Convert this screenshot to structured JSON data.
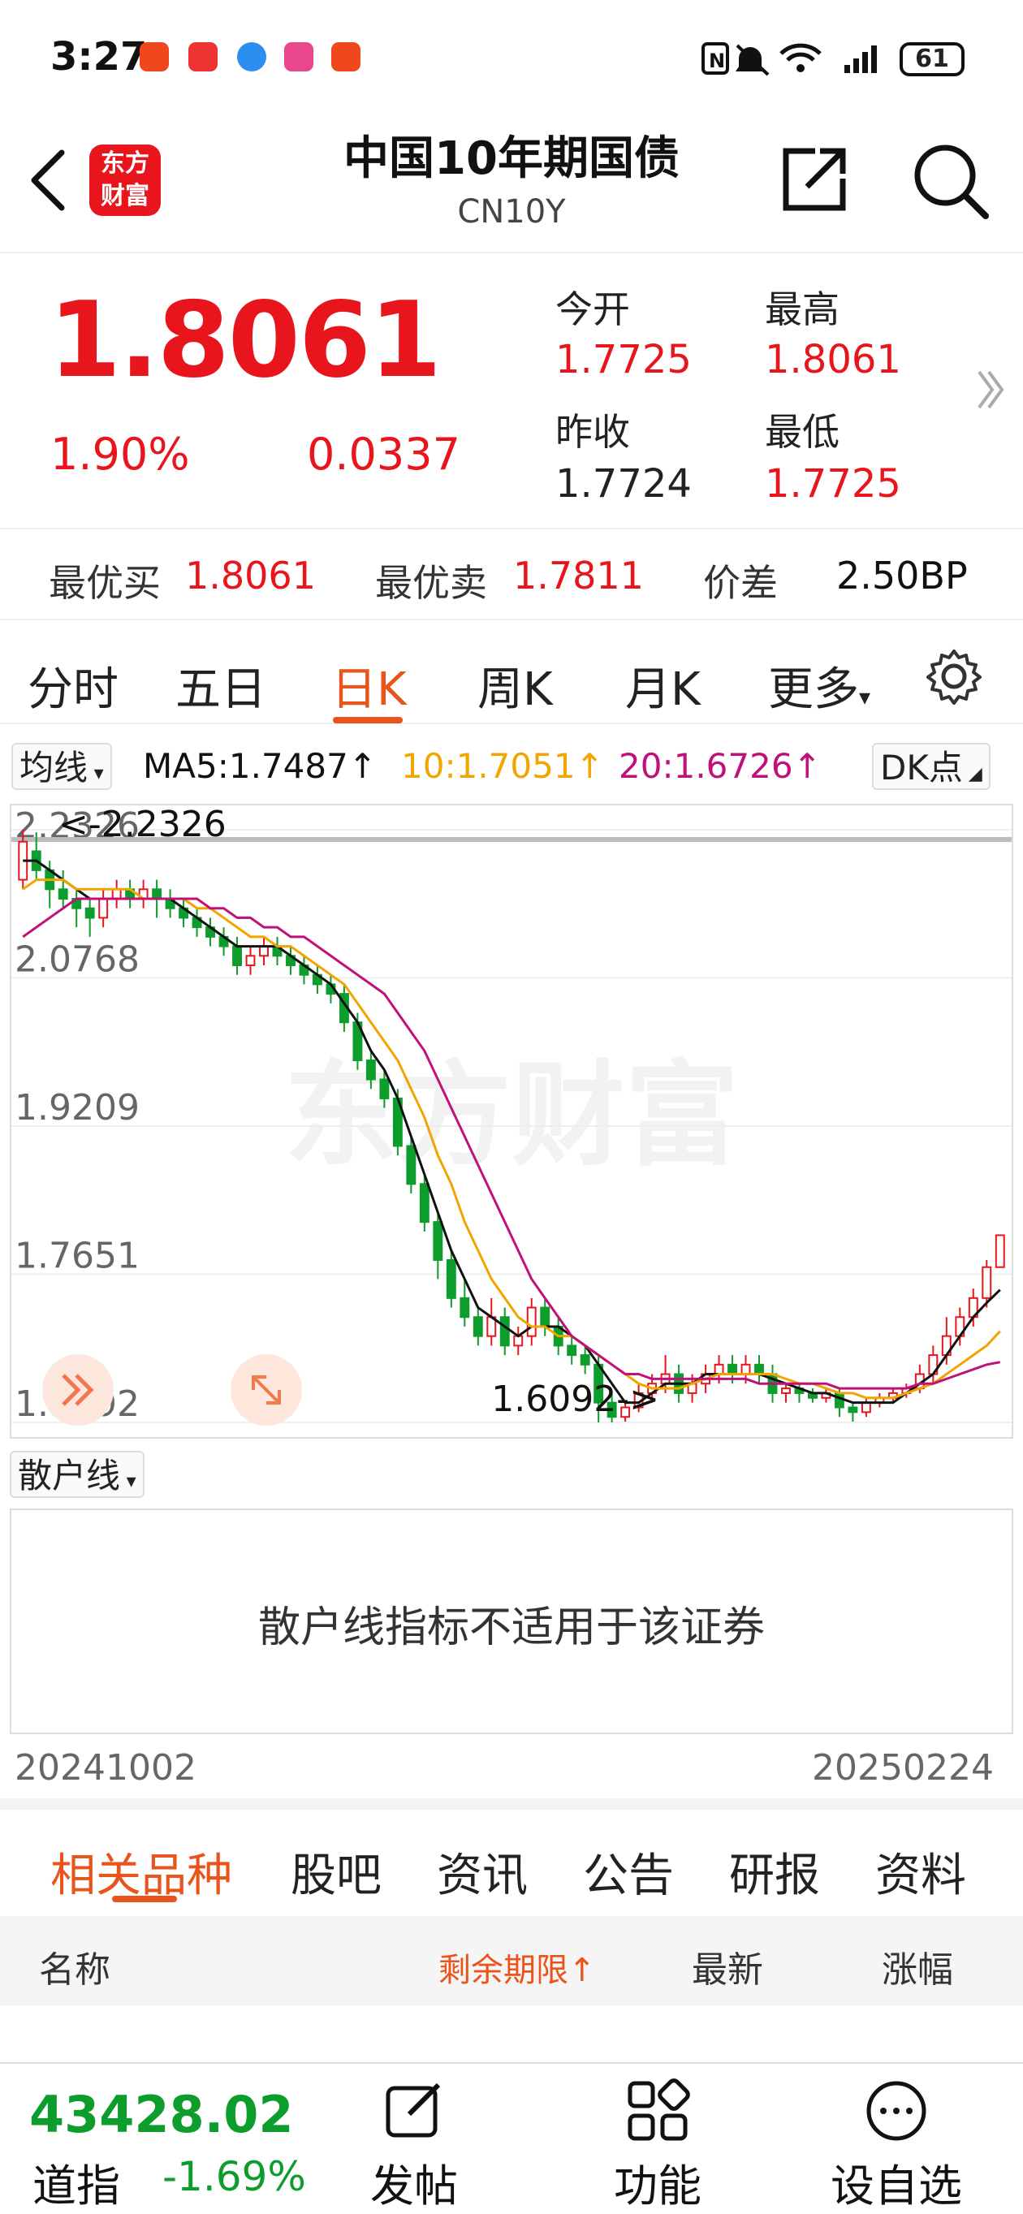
{
  "status": {
    "time": "3:27",
    "battery": "61"
  },
  "header": {
    "title": "中国10年期国债",
    "code": "CN10Y",
    "logo_line1": "东方",
    "logo_line2": "财富"
  },
  "quote": {
    "price": "1.8061",
    "pct": "1.90%",
    "change": "0.0337",
    "open_label": "今开",
    "open": "1.7725",
    "high_label": "最高",
    "high": "1.8061",
    "prev_label": "昨收",
    "prev": "1.7724",
    "low_label": "最低",
    "low": "1.7725"
  },
  "bidask": {
    "bid_label": "最优买",
    "bid": "1.8061",
    "ask_label": "最优卖",
    "ask": "1.7811",
    "spread_label": "价差",
    "spread": "2.50BP"
  },
  "ktabs": [
    "分时",
    "五日",
    "日K",
    "周K",
    "月K",
    "更多"
  ],
  "ma": {
    "selector": "均线",
    "ma5": "MA5:1.7487↑",
    "ma10": "10:1.7051↑",
    "ma20": "20:1.6726↑",
    "dk": "DK点"
  },
  "colors": {
    "up": "#e8161c",
    "down": "#0d9d2c",
    "ma5": "#111111",
    "ma10": "#f0a500",
    "ma20": "#c0117b",
    "accent": "#e8541b"
  },
  "chart_data": {
    "type": "candlestick",
    "y_ticks": [
      "2.2326",
      "2.0768",
      "1.9209",
      "1.7651",
      "1.6092"
    ],
    "ylim": [
      1.6092,
      2.2326
    ],
    "high_marker": "<-2.2326",
    "low_marker": "1.6092->",
    "watermark": "东方财富",
    "x_range": [
      "20241002",
      "20250224"
    ],
    "candles": [
      [
        2.18,
        2.22,
        2.2326,
        2.17
      ],
      [
        2.21,
        2.19,
        2.23,
        2.18
      ],
      [
        2.19,
        2.17,
        2.2,
        2.15
      ],
      [
        2.17,
        2.16,
        2.19,
        2.15
      ],
      [
        2.16,
        2.15,
        2.17,
        2.13
      ],
      [
        2.15,
        2.14,
        2.16,
        2.12
      ],
      [
        2.14,
        2.16,
        2.17,
        2.13
      ],
      [
        2.16,
        2.17,
        2.18,
        2.15
      ],
      [
        2.17,
        2.16,
        2.18,
        2.15
      ],
      [
        2.16,
        2.17,
        2.18,
        2.15
      ],
      [
        2.17,
        2.16,
        2.18,
        2.14
      ],
      [
        2.16,
        2.15,
        2.17,
        2.14
      ],
      [
        2.15,
        2.14,
        2.16,
        2.13
      ],
      [
        2.14,
        2.13,
        2.15,
        2.12
      ],
      [
        2.13,
        2.12,
        2.14,
        2.11
      ],
      [
        2.12,
        2.11,
        2.13,
        2.1
      ],
      [
        2.11,
        2.09,
        2.12,
        2.08
      ],
      [
        2.09,
        2.1,
        2.11,
        2.08
      ],
      [
        2.1,
        2.11,
        2.12,
        2.09
      ],
      [
        2.11,
        2.1,
        2.12,
        2.09
      ],
      [
        2.1,
        2.09,
        2.11,
        2.08
      ],
      [
        2.09,
        2.08,
        2.1,
        2.07
      ],
      [
        2.08,
        2.07,
        2.09,
        2.06
      ],
      [
        2.07,
        2.06,
        2.08,
        2.05
      ],
      [
        2.06,
        2.03,
        2.07,
        2.02
      ],
      [
        2.03,
        1.99,
        2.04,
        1.98
      ],
      [
        1.99,
        1.97,
        2.0,
        1.96
      ],
      [
        1.97,
        1.95,
        1.98,
        1.94
      ],
      [
        1.95,
        1.9,
        1.96,
        1.89
      ],
      [
        1.9,
        1.86,
        1.91,
        1.85
      ],
      [
        1.86,
        1.82,
        1.87,
        1.81
      ],
      [
        1.82,
        1.78,
        1.83,
        1.76
      ],
      [
        1.78,
        1.74,
        1.79,
        1.73
      ],
      [
        1.74,
        1.72,
        1.76,
        1.71
      ],
      [
        1.72,
        1.7,
        1.73,
        1.69
      ],
      [
        1.7,
        1.72,
        1.74,
        1.69
      ],
      [
        1.72,
        1.69,
        1.73,
        1.68
      ],
      [
        1.69,
        1.7,
        1.71,
        1.68
      ],
      [
        1.7,
        1.73,
        1.74,
        1.69
      ],
      [
        1.73,
        1.71,
        1.74,
        1.7
      ],
      [
        1.71,
        1.69,
        1.72,
        1.68
      ],
      [
        1.69,
        1.68,
        1.7,
        1.67
      ],
      [
        1.68,
        1.67,
        1.69,
        1.66
      ],
      [
        1.67,
        1.63,
        1.68,
        1.6092
      ],
      [
        1.63,
        1.615,
        1.64,
        1.6092
      ],
      [
        1.615,
        1.625,
        1.63,
        1.61
      ],
      [
        1.625,
        1.64,
        1.65,
        1.62
      ],
      [
        1.64,
        1.65,
        1.66,
        1.63
      ],
      [
        1.65,
        1.66,
        1.68,
        1.64
      ],
      [
        1.66,
        1.64,
        1.67,
        1.63
      ],
      [
        1.64,
        1.65,
        1.66,
        1.63
      ],
      [
        1.65,
        1.66,
        1.67,
        1.64
      ],
      [
        1.66,
        1.67,
        1.68,
        1.65
      ],
      [
        1.67,
        1.66,
        1.68,
        1.65
      ],
      [
        1.66,
        1.67,
        1.68,
        1.65
      ],
      [
        1.67,
        1.66,
        1.68,
        1.65
      ],
      [
        1.66,
        1.64,
        1.67,
        1.63
      ],
      [
        1.64,
        1.645,
        1.65,
        1.63
      ],
      [
        1.645,
        1.64,
        1.65,
        1.63
      ],
      [
        1.64,
        1.635,
        1.645,
        1.63
      ],
      [
        1.635,
        1.64,
        1.645,
        1.63
      ],
      [
        1.64,
        1.625,
        1.645,
        1.615
      ],
      [
        1.625,
        1.62,
        1.63,
        1.61
      ],
      [
        1.62,
        1.63,
        1.635,
        1.615
      ],
      [
        1.63,
        1.635,
        1.64,
        1.625
      ],
      [
        1.635,
        1.64,
        1.645,
        1.63
      ],
      [
        1.64,
        1.645,
        1.65,
        1.635
      ],
      [
        1.645,
        1.66,
        1.67,
        1.64
      ],
      [
        1.66,
        1.68,
        1.69,
        1.65
      ],
      [
        1.68,
        1.7,
        1.72,
        1.67
      ],
      [
        1.7,
        1.72,
        1.73,
        1.69
      ],
      [
        1.72,
        1.74,
        1.75,
        1.71
      ],
      [
        1.74,
        1.7725,
        1.78,
        1.73
      ],
      [
        1.7725,
        1.8061,
        1.8061,
        1.7725
      ]
    ],
    "ma5": [
      2.2,
      2.2,
      2.19,
      2.18,
      2.17,
      2.16,
      2.16,
      2.16,
      2.16,
      2.16,
      2.16,
      2.16,
      2.15,
      2.14,
      2.13,
      2.12,
      2.11,
      2.11,
      2.11,
      2.11,
      2.1,
      2.09,
      2.08,
      2.07,
      2.05,
      2.03,
      2.0,
      1.98,
      1.95,
      1.91,
      1.87,
      1.83,
      1.79,
      1.76,
      1.73,
      1.72,
      1.71,
      1.7,
      1.71,
      1.71,
      1.71,
      1.7,
      1.69,
      1.67,
      1.65,
      1.63,
      1.63,
      1.64,
      1.65,
      1.65,
      1.65,
      1.66,
      1.66,
      1.66,
      1.66,
      1.66,
      1.655,
      1.65,
      1.645,
      1.64,
      1.64,
      1.635,
      1.63,
      1.63,
      1.63,
      1.63,
      1.64,
      1.65,
      1.66,
      1.68,
      1.7,
      1.72,
      1.735,
      1.7487
    ],
    "ma10": [
      2.17,
      2.18,
      2.18,
      2.18,
      2.17,
      2.17,
      2.17,
      2.17,
      2.17,
      2.16,
      2.16,
      2.16,
      2.16,
      2.15,
      2.15,
      2.14,
      2.13,
      2.12,
      2.12,
      2.11,
      2.11,
      2.1,
      2.09,
      2.08,
      2.07,
      2.05,
      2.03,
      2.01,
      1.99,
      1.96,
      1.93,
      1.89,
      1.86,
      1.82,
      1.79,
      1.76,
      1.74,
      1.72,
      1.71,
      1.71,
      1.7,
      1.7,
      1.69,
      1.68,
      1.67,
      1.66,
      1.65,
      1.645,
      1.645,
      1.645,
      1.65,
      1.655,
      1.66,
      1.66,
      1.66,
      1.66,
      1.66,
      1.655,
      1.65,
      1.65,
      1.645,
      1.64,
      1.64,
      1.635,
      1.635,
      1.635,
      1.64,
      1.645,
      1.65,
      1.66,
      1.67,
      1.68,
      1.69,
      1.7051
    ],
    "ma20": [
      2.12,
      2.13,
      2.14,
      2.15,
      2.16,
      2.16,
      2.16,
      2.16,
      2.16,
      2.16,
      2.16,
      2.16,
      2.16,
      2.16,
      2.15,
      2.15,
      2.14,
      2.14,
      2.13,
      2.13,
      2.12,
      2.12,
      2.11,
      2.1,
      2.09,
      2.08,
      2.07,
      2.06,
      2.04,
      2.02,
      2.0,
      1.97,
      1.94,
      1.91,
      1.88,
      1.85,
      1.82,
      1.79,
      1.76,
      1.74,
      1.72,
      1.7,
      1.69,
      1.68,
      1.67,
      1.66,
      1.66,
      1.655,
      1.655,
      1.655,
      1.655,
      1.655,
      1.655,
      1.655,
      1.655,
      1.65,
      1.65,
      1.65,
      1.65,
      1.65,
      1.65,
      1.645,
      1.645,
      1.645,
      1.645,
      1.645,
      1.645,
      1.65,
      1.65,
      1.655,
      1.66,
      1.665,
      1.67,
      1.6726
    ]
  },
  "indicator": {
    "selector": "散户线",
    "message": "散户线指标不适用于该证券"
  },
  "dates": {
    "start": "20241002",
    "end": "20250224"
  },
  "related_tabs": [
    "相关品种",
    "股吧",
    "资讯",
    "公告",
    "研报",
    "资料"
  ],
  "columns": {
    "name": "名称",
    "remaining": "剩余期限↑",
    "latest": "最新",
    "change": "涨幅"
  },
  "bottom": {
    "index_value": "43428.02",
    "index_name": "道指",
    "index_pct": "-1.69%",
    "post": "发帖",
    "func": "功能",
    "watch": "设自选"
  }
}
